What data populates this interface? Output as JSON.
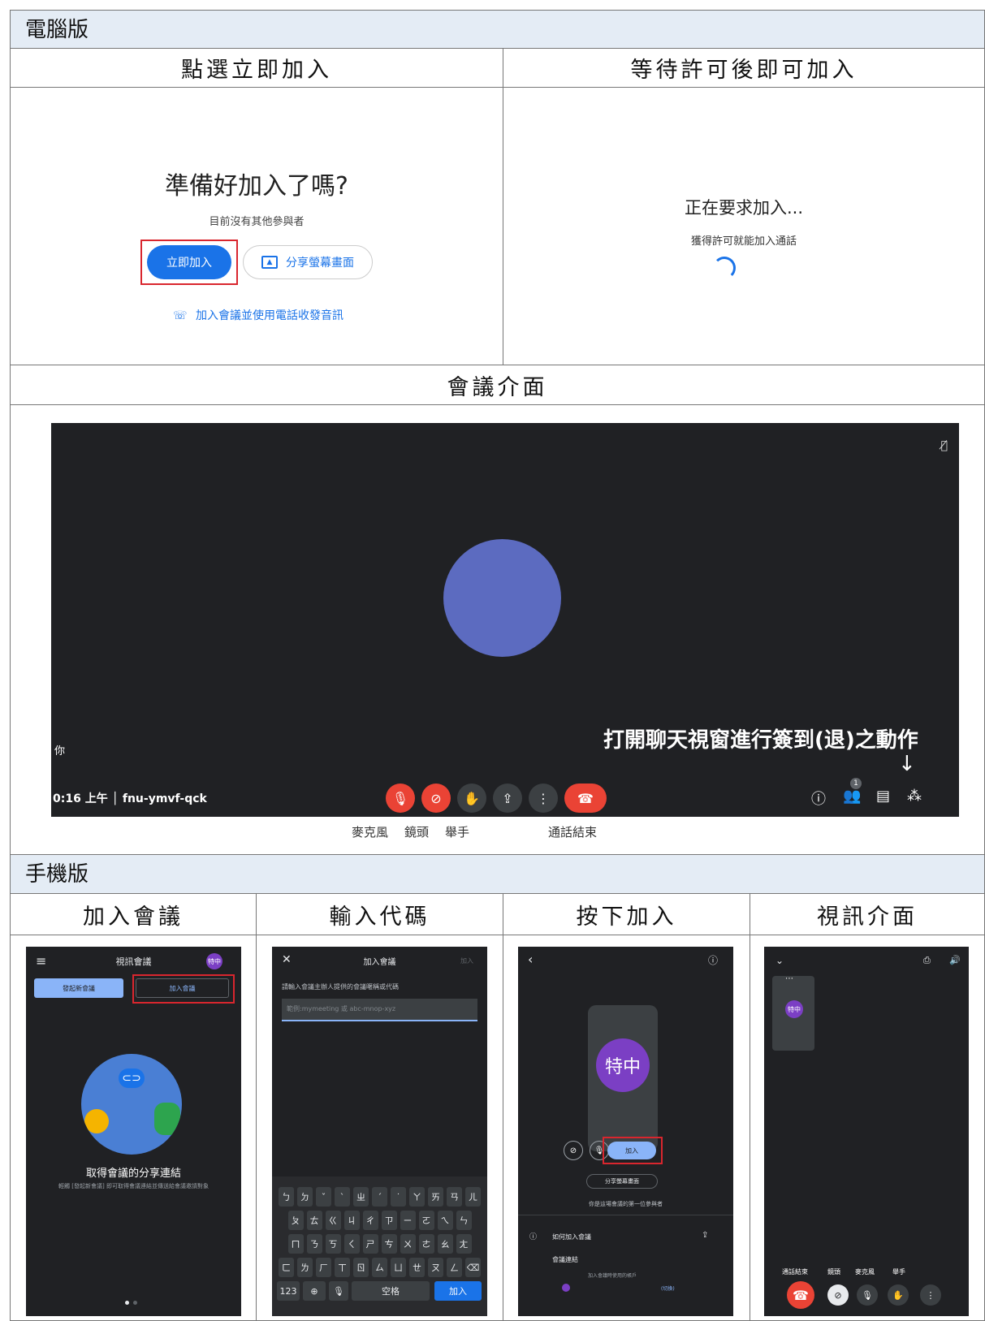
{
  "desktop_section": "電腦版",
  "col_join_now": "點選立即加入",
  "col_wait": "等待許可後即可加入",
  "join_panel": {
    "title": "準備好加入了嗎?",
    "subtitle": "目前沒有其他參與者",
    "join_button": "立即加入",
    "share_button": "分享螢幕畫面",
    "phone_link": "加入會議並使用電話收發音訊"
  },
  "wait_panel": {
    "title": "正在要求加入...",
    "subtitle": "獲得許可就能加入通話"
  },
  "meeting_header": "會議介面",
  "meeting": {
    "you_label": "你",
    "time_code": "0:16 上午 │ fnu-ymvf-qck",
    "annotation": "打開聊天視窗進行簽到(退)之動作",
    "arrow": "↓",
    "people_count": "1",
    "caption_mic": "麥克風",
    "caption_camera": "鏡頭",
    "caption_hand": "舉手",
    "caption_end": "通話結束"
  },
  "mobile_section": "手機版",
  "mobile_cols": [
    "加入會議",
    "輸入代碼",
    "按下加入",
    "視訊介面"
  ],
  "phone1": {
    "title": "視訊會議",
    "avatar": "特中",
    "new_meeting": "發起新會議",
    "join_meeting": "加入會議",
    "heading": "取得會議的分享連結",
    "desc": "輕觸 [發起新會議] 即可取得會議連結並傳送給會議邀請對象"
  },
  "phone2": {
    "title": "加入會議",
    "join": "加入",
    "prompt": "請輸入會議主辦人提供的會議暱稱或代碼",
    "placeholder": "範例:mymeeting 或 abc-mnop-xyz",
    "rows": [
      [
        "ㄅ",
        "ㄉ",
        "ˇ",
        "ˋ",
        "ㄓ",
        "ˊ",
        "˙",
        "ㄚ",
        "ㄞ",
        "ㄢ",
        "ㄦ"
      ],
      [
        "ㄆ",
        "ㄊ",
        "ㄍ",
        "ㄐ",
        "ㄔ",
        "ㄗ",
        "ㄧ",
        "ㄛ",
        "ㄟ",
        "ㄣ"
      ],
      [
        "ㄇ",
        "ㄋ",
        "ㄎ",
        "ㄑ",
        "ㄕ",
        "ㄘ",
        "ㄨ",
        "ㄜ",
        "ㄠ",
        "ㄤ"
      ],
      [
        "ㄈ",
        "ㄌ",
        "ㄏ",
        "ㄒ",
        "ㄖ",
        "ㄙ",
        "ㄩ",
        "ㄝ",
        "ㄡ",
        "ㄥ",
        "⌫"
      ]
    ],
    "key_123": "123",
    "key_space": "空格",
    "key_join": "加入"
  },
  "phone3": {
    "avatar": "特中",
    "join": "加入",
    "share": "分享螢幕畫面",
    "first": "你是這場會議的第一位參與者",
    "how": "如何加入會議",
    "link": "會議連結",
    "account": "加入會議時使用的帳戶",
    "switch": "(切換)"
  },
  "phone4": {
    "avatar": "特中",
    "labels": [
      "通話結束",
      "鏡頭",
      "麥克風",
      "舉手"
    ]
  }
}
